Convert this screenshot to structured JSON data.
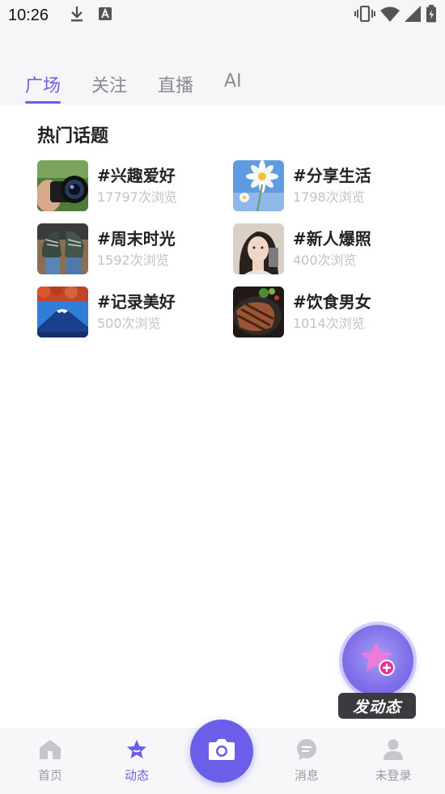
{
  "status_bar": {
    "time": "10:26",
    "icons": [
      "download-icon",
      "text-a-icon",
      "vibrate-icon",
      "wifi-icon",
      "signal-icon",
      "battery-icon"
    ]
  },
  "tabs": [
    {
      "label": "广场",
      "active": true
    },
    {
      "label": "关注",
      "active": false
    },
    {
      "label": "直播",
      "active": false
    },
    {
      "label": "AI",
      "active": false
    }
  ],
  "section": {
    "title": "热门话题"
  },
  "topics": [
    {
      "name": "#兴趣爱好",
      "views": "17797次浏览",
      "thumb": "camera-photo"
    },
    {
      "name": "#分享生活",
      "views": "1798次浏览",
      "thumb": "daisy-photo"
    },
    {
      "name": "#周末时光",
      "views": "1592次浏览",
      "thumb": "shoes-photo"
    },
    {
      "name": "#新人爆照",
      "views": "400次浏览",
      "thumb": "portrait-photo"
    },
    {
      "name": "#记录美好",
      "views": "500次浏览",
      "thumb": "mountain-photo"
    },
    {
      "name": "#饮食男女",
      "views": "1014次浏览",
      "thumb": "steak-photo"
    }
  ],
  "fab": {
    "label": "发动态"
  },
  "bottom_nav": [
    {
      "label": "首页",
      "icon": "home-icon",
      "active": false
    },
    {
      "label": "动态",
      "icon": "star-icon",
      "active": true
    },
    {
      "label": "消息",
      "icon": "message-icon",
      "active": false
    },
    {
      "label": "未登录",
      "icon": "user-icon",
      "active": false
    }
  ],
  "colors": {
    "accent": "#6b5ee8",
    "muted": "#8a8a8f"
  }
}
